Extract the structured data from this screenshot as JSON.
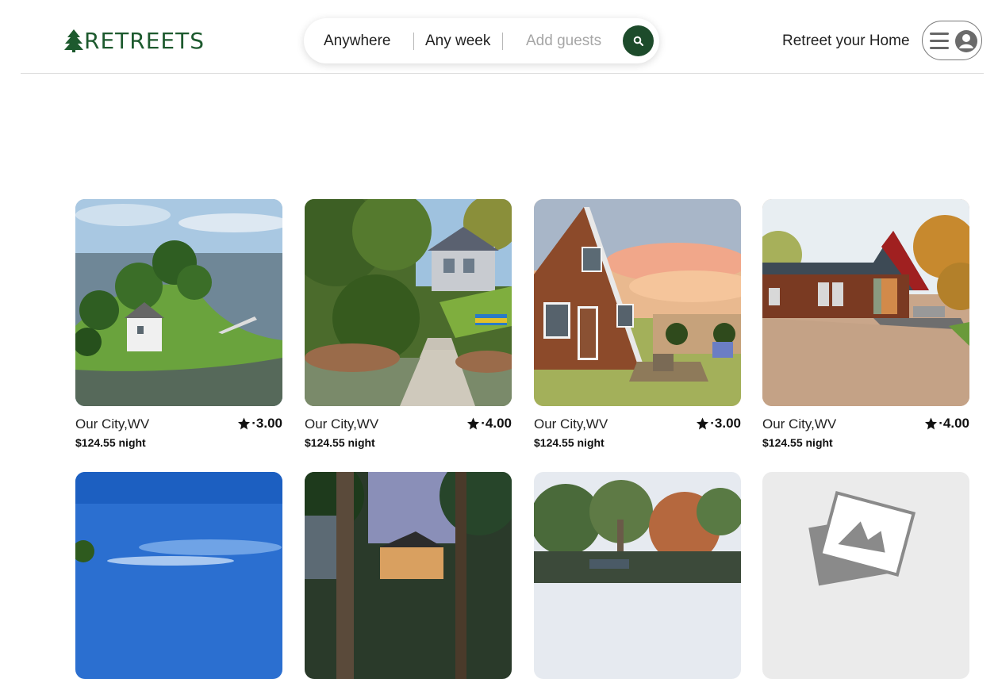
{
  "brand": {
    "name": "RETREETS",
    "color": "#1d5a2e"
  },
  "search": {
    "where_label": "Anywhere",
    "when_label": "Any week",
    "guests_placeholder": "Add guests",
    "button_color": "#1d4b2b",
    "icon": "search-icon"
  },
  "header": {
    "host_link": "Retreet your Home",
    "menu_icon": "hamburger-icon",
    "avatar_icon": "user-circle-icon"
  },
  "listings": [
    {
      "location": "Our City,WV",
      "rating": "·3.00",
      "price": "$124.55 night",
      "image": "lakeside-island-cottage"
    },
    {
      "location": "Our City,WV",
      "rating": "·4.00",
      "price": "$124.55 night",
      "image": "lake-house-with-dock"
    },
    {
      "location": "Our City,WV",
      "rating": "·3.00",
      "price": "$124.55 night",
      "image": "a-frame-cabin-sunset"
    },
    {
      "location": "Our City,WV",
      "rating": "·4.00",
      "price": "$124.55 night",
      "image": "red-log-cabin-autumn"
    },
    {
      "location": "",
      "rating": "",
      "price": "",
      "image": "blue-sky-coast"
    },
    {
      "location": "",
      "rating": "",
      "price": "",
      "image": "forest-cabin-dusk"
    },
    {
      "location": "",
      "rating": "",
      "price": "",
      "image": "autumn-trees-cabin"
    },
    {
      "location": "",
      "rating": "",
      "price": "",
      "image": "placeholder-photo"
    }
  ]
}
